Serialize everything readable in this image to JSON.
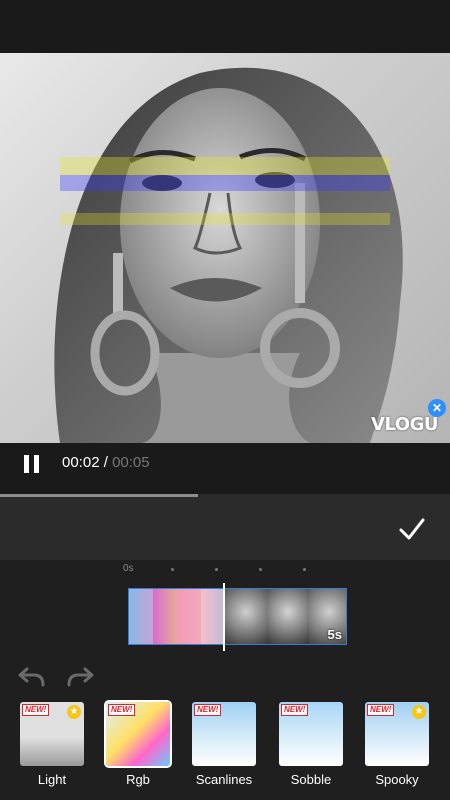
{
  "player": {
    "current_time": "00:02",
    "separator": " / ",
    "total_time": "00:05",
    "progress": 0.44
  },
  "watermark": {
    "text": "VLOGU",
    "close_icon": "close-icon"
  },
  "timeline": {
    "ruler_start": "0s",
    "clip_duration": "5s"
  },
  "effects": [
    {
      "label": "Light",
      "badge": "NEW!",
      "premium": true
    },
    {
      "label": "Rgb",
      "badge": "NEW!",
      "premium": false
    },
    {
      "label": "Scanlines",
      "badge": "NEW!",
      "premium": false
    },
    {
      "label": "Sobble",
      "badge": "NEW!",
      "premium": false
    },
    {
      "label": "Spooky",
      "badge": "NEW!",
      "premium": true
    }
  ],
  "colors": {
    "accent": "#2f8fff",
    "badge_red": "#e5202a",
    "star": "#f5c518"
  }
}
